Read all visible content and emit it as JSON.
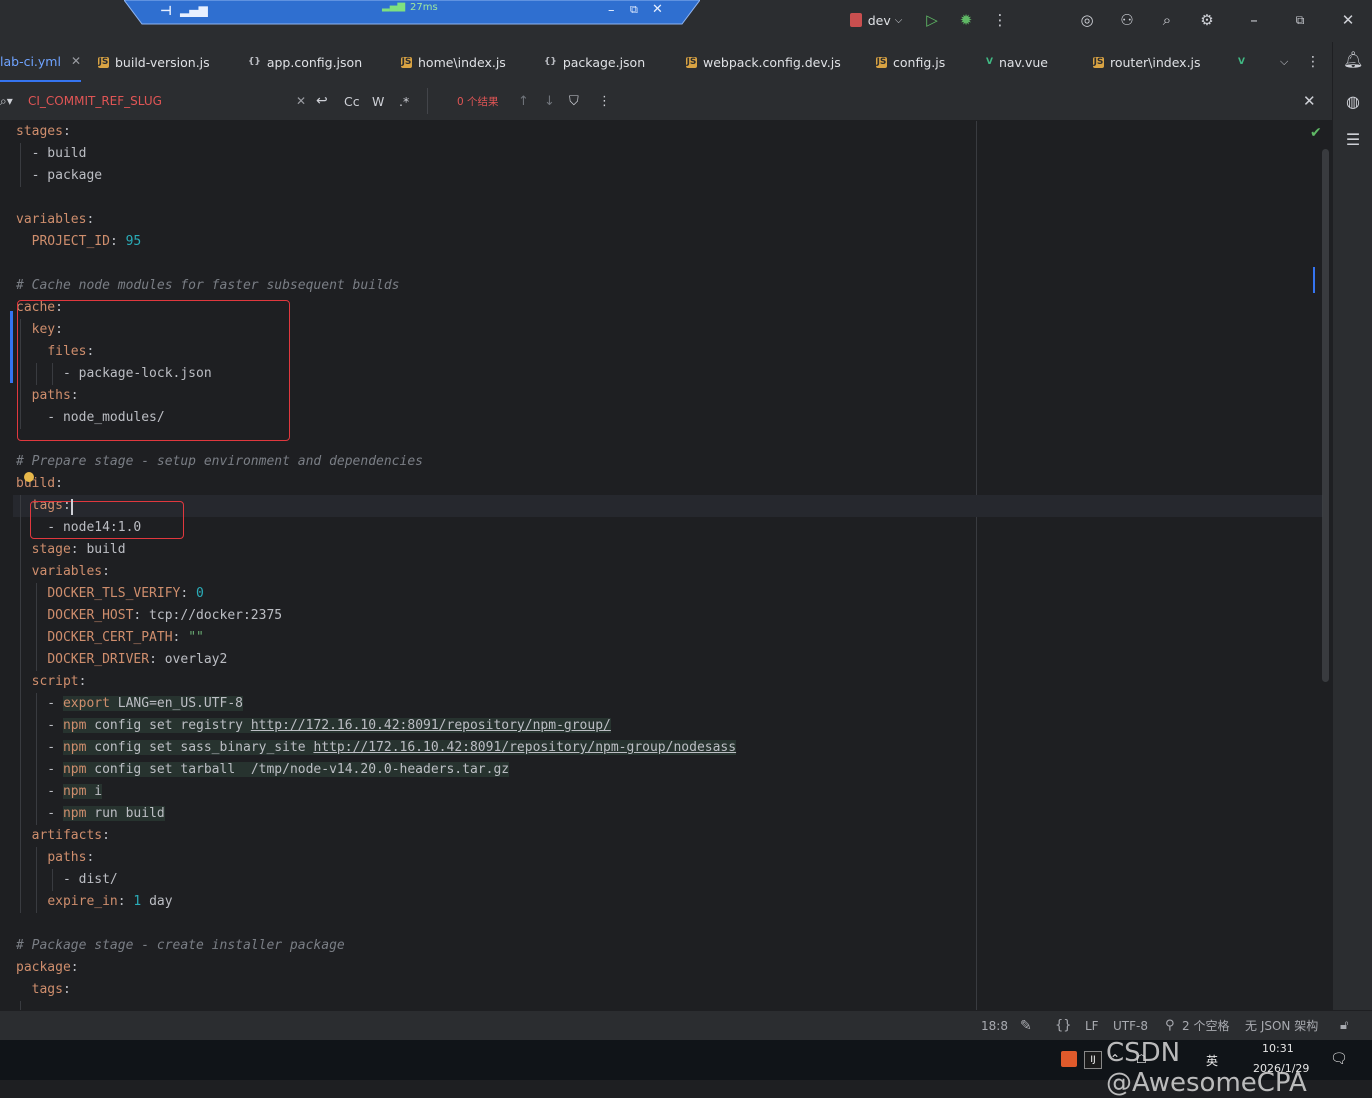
{
  "remote_bar": {
    "latency": "27ms"
  },
  "titlebar": {
    "branch": "dev"
  },
  "tabs": [
    {
      "label": "lab-ci.yml",
      "type": "yml",
      "active": true
    },
    {
      "label": "build-version.js",
      "type": "js"
    },
    {
      "label": "app.config.json",
      "type": "json"
    },
    {
      "label": "home\\index.js",
      "type": "js"
    },
    {
      "label": "package.json",
      "type": "json"
    },
    {
      "label": "webpack.config.dev.js",
      "type": "js"
    },
    {
      "label": "config.js",
      "type": "js"
    },
    {
      "label": "nav.vue",
      "type": "vue"
    },
    {
      "label": "router\\index.js",
      "type": "js"
    }
  ],
  "find": {
    "query": "CI_COMMIT_REF_SLUG",
    "match_case": "Cc",
    "words": "W",
    "regex": ".*",
    "results": "0 个结果"
  },
  "code": {
    "lines": [
      "stages:",
      "  - build",
      "  - package",
      "",
      "variables:",
      "  PROJECT_ID: 95",
      "",
      "# Cache node modules for faster subsequent builds",
      "cache:",
      "  key:",
      "    files:",
      "      - package-lock.json",
      "  paths:",
      "    - node_modules/",
      "",
      "# Prepare stage - setup environment and dependencies",
      "build:",
      "  tags:",
      "    - node14:1.0",
      "  stage: build",
      "  variables:",
      "    DOCKER_TLS_VERIFY: 0",
      "    DOCKER_HOST: tcp://docker:2375",
      "    DOCKER_CERT_PATH: \"\"",
      "    DOCKER_DRIVER: overlay2",
      "  script:",
      "    - export LANG=en_US.UTF-8",
      "    - npm config set registry http://172.16.10.42:8091/repository/npm-group/",
      "    - npm config set sass_binary_site http://172.16.10.42:8091/repository/npm-group/nodesass",
      "    - npm config set tarball  /tmp/node-v14.20.0-headers.tar.gz",
      "    - npm i",
      "    - npm run build",
      "  artifacts:",
      "    paths:",
      "      - dist/",
      "    expire_in: 1 day",
      "",
      "# Package stage - create installer package",
      "package:",
      "  tags:"
    ]
  },
  "status": {
    "position": "18:8",
    "line_ending": "LF",
    "encoding": "UTF-8",
    "indent": "2 个空格",
    "schema": "无 JSON 架构"
  },
  "taskbar": {
    "time": "10:31",
    "date": "2026/1/29",
    "ime": "英"
  },
  "watermark": "CSDN @AwesomeCPA"
}
